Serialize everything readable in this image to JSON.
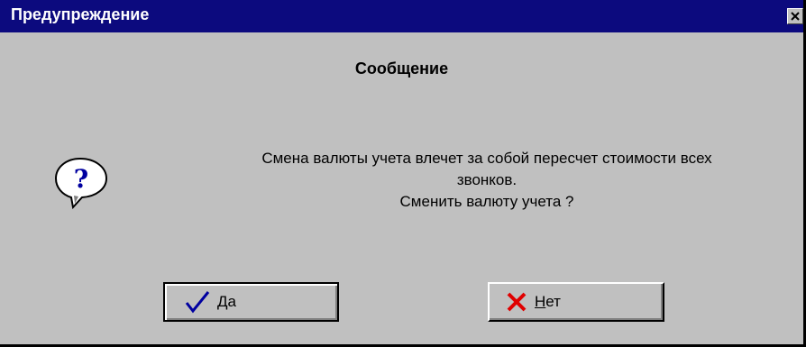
{
  "window": {
    "title": "Предупреждение",
    "close_symbol": "×",
    "icon": "close-icon"
  },
  "dialog": {
    "heading": "Сообщение",
    "icon": "question-icon",
    "message_lines": [
      "Смена валюты учета влечет за собой пересчет стоимости всех",
      "звонков.",
      "Сменить валюту учета ?"
    ],
    "buttons": {
      "yes": {
        "mnemonic": "Д",
        "rest": "а",
        "icon": "checkmark-icon"
      },
      "no": {
        "mnemonic": "Н",
        "rest": "ет",
        "icon": "cross-icon"
      }
    }
  },
  "colors": {
    "title_bar": "#0c0a7e",
    "face": "#c0c0c0",
    "checkmark": "#0000a0",
    "cross": "#e00000"
  }
}
